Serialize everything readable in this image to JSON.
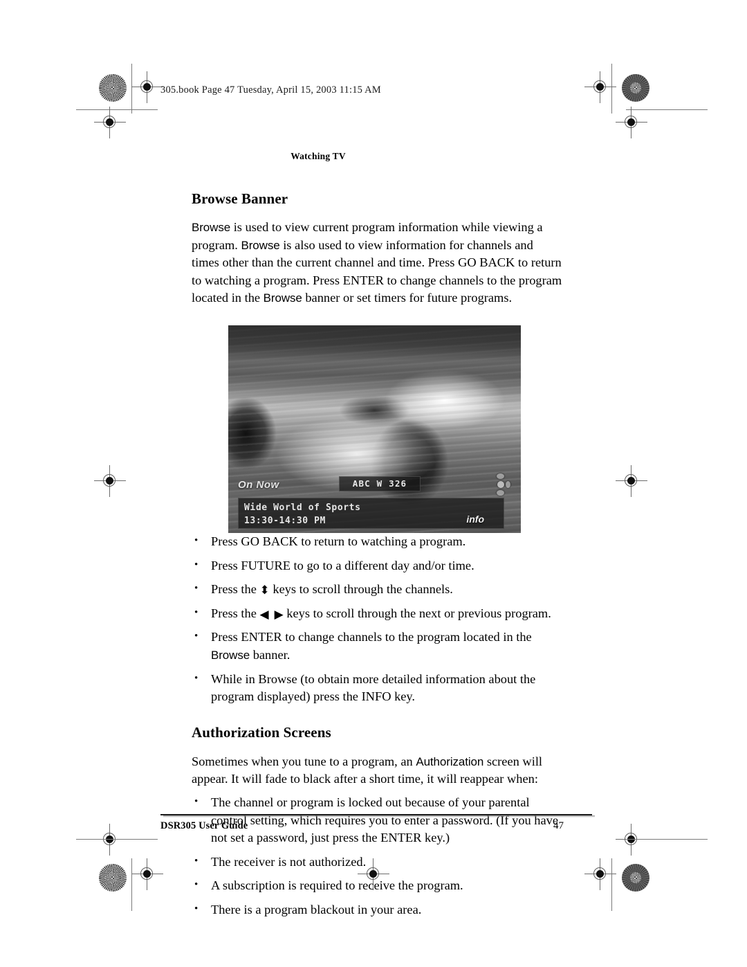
{
  "page": {
    "book_header": "305.book  Page 47  Tuesday, April 15, 2003  11:15 AM",
    "running_head": "Watching TV"
  },
  "sections": [
    {
      "id": "browse-banner",
      "title": "Browse Banner",
      "paragraphs": [
        {
          "runs": [
            {
              "text": "Browse",
              "style": "ui"
            },
            {
              "text": " is used to view current program information while viewing a program. ",
              "style": "normal"
            },
            {
              "text": "Browse",
              "style": "ui"
            },
            {
              "text": " is also used to view information for channels and times other than the current channel and time. Press GO BACK to return to watching a program. Press ENTER to change channels to the program located in the ",
              "style": "normal"
            },
            {
              "text": "Browse",
              "style": "ui"
            },
            {
              "text": " banner or set timers for future programs.",
              "style": "normal"
            }
          ]
        }
      ],
      "bullets": [
        "Press GO BACK to return to watching a program.",
        "Press FUTURE to go to a different day and/or time.",
        "Press the ⬍ keys to scroll through the channels.",
        "Press the ◀ ▶ keys to scroll through the next or previous program.",
        "Press ENTER to change channels to the program located in the Browse banner.",
        "While in Browse (to obtain more detailed information about the program displayed) press the INFO key."
      ]
    },
    {
      "id": "authorization-screens",
      "title": "Authorization Screens",
      "intro_runs": [
        {
          "text": "Sometimes when you tune to a program, an ",
          "style": "normal"
        },
        {
          "text": "Authorization",
          "style": "ui"
        },
        {
          "text": " screen will appear. It will fade to black after a short time, it will reappear when:",
          "style": "normal"
        }
      ],
      "bullets": [
        "The channel or program is locked out because of your parental control setting, which requires you to enter a password. (If you have not set a password, just press the ENTER key.)",
        "The receiver is not authorized.",
        "A subscription is required to receive the program.",
        "There is a program blackout in your area."
      ]
    }
  ],
  "figure": {
    "alt": "Television screen showing a race car with the Browse banner overlay",
    "banner": {
      "on_now_label": "On Now",
      "channel": "ABC W 326",
      "program_title": "Wide World of Sports",
      "program_time": "13:30-14:30 PM",
      "info_label": "info"
    }
  },
  "footer": {
    "left": "DSR305 User Guide",
    "page_number": "47"
  },
  "bullet_text": {
    "b1": "Press GO BACK to return to watching a program.",
    "b2": "Press FUTURE to go to a different day and/or time.",
    "b3_pre": "Press the",
    "b3_glyph": "⬍",
    "b3_post": "keys to scroll through the channels.",
    "b4_pre": "Press the",
    "b4_glyph_left": "◀",
    "b4_glyph_right": "▶",
    "b4_post": "keys to scroll through the next or previous program.",
    "b5_pre": "Press ENTER to change channels to the program located in the ",
    "b5_ui": "Browse",
    "b5_post": " banner.",
    "b6": "While in Browse (to obtain more detailed information about the program displayed) press the INFO key.",
    "a1": "The channel or program is locked out because of your parental control setting, which requires you to enter a password. (If you have not set a password, just press the ENTER key.)",
    "a2": "The receiver is not authorized.",
    "a3": "A subscription is required to receive the program.",
    "a4": "There is a program blackout in your area."
  },
  "para_text": {
    "p1_a": "Browse",
    "p1_b": " is used to view current program information while viewing a program. ",
    "p1_c": "Browse",
    "p1_d": " is also used to view information for channels and times other than the current channel and time. Press GO BACK to return to watching a program. Press ENTER to change channels to the program located in the ",
    "p1_e": "Browse",
    "p1_f": " banner or set timers for future programs.",
    "auth_a": "Sometimes when you tune to a program, an ",
    "auth_b": "Authorization",
    "auth_c": " screen will appear. It will fade to black after a short time, it will reappear when:"
  },
  "titles": {
    "browse_banner": "Browse Banner",
    "authorization_screens": "Authorization Screens"
  }
}
